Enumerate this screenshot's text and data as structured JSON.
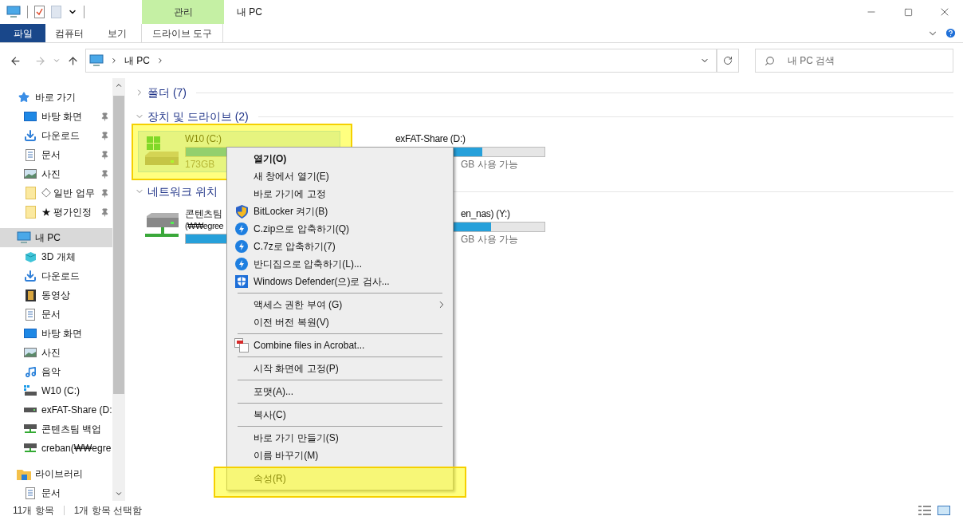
{
  "window": {
    "title": "내 PC",
    "context_tab_group": "관리"
  },
  "ribbon_tabs": [
    {
      "label": "파일",
      "kind": "file"
    },
    {
      "label": "컴퓨터",
      "kind": "tab"
    },
    {
      "label": "보기",
      "kind": "tab"
    },
    {
      "label": "드라이브 도구",
      "kind": "context"
    }
  ],
  "address_bar": {
    "segments": [
      "내 PC"
    ]
  },
  "search": {
    "placeholder": "내 PC 검색"
  },
  "nav": [
    {
      "label": "바로 가기",
      "kind": "star",
      "selected": false,
      "children": [
        {
          "label": "바탕 화면",
          "kind": "desktop",
          "pinned": true,
          "selected": false
        },
        {
          "label": "다운로드",
          "kind": "download",
          "pinned": true,
          "selected": false
        },
        {
          "label": "문서",
          "kind": "document",
          "pinned": true,
          "selected": false
        },
        {
          "label": "사진",
          "kind": "picture",
          "pinned": true,
          "selected": false
        },
        {
          "label": "◇ 일반 업무",
          "kind": "folder",
          "pinned": true,
          "selected": false
        },
        {
          "label": "★ 평가인정",
          "kind": "folder",
          "pinned": true,
          "selected": false
        }
      ]
    },
    {
      "label": "내 PC",
      "kind": "pc",
      "selected": true,
      "children": [
        {
          "label": "3D 개체",
          "kind": "cube",
          "pinned": false,
          "selected": false
        },
        {
          "label": "다운로드",
          "kind": "download",
          "pinned": false,
          "selected": false
        },
        {
          "label": "동영상",
          "kind": "video",
          "pinned": false,
          "selected": false
        },
        {
          "label": "문서",
          "kind": "document",
          "pinned": false,
          "selected": false
        },
        {
          "label": "바탕 화면",
          "kind": "desktop",
          "pinned": false,
          "selected": false
        },
        {
          "label": "사진",
          "kind": "picture",
          "pinned": false,
          "selected": false
        },
        {
          "label": "음악",
          "kind": "music",
          "pinned": false,
          "selected": false
        },
        {
          "label": "W10 (C:)",
          "kind": "windrive",
          "pinned": false,
          "selected": false
        },
        {
          "label": "exFAT-Share (D:",
          "kind": "drive",
          "pinned": false,
          "selected": false
        },
        {
          "label": "콘텐츠팀 백업",
          "kind": "netdrive",
          "pinned": false,
          "selected": false
        },
        {
          "label": "creban(₩₩egre",
          "kind": "netdrive",
          "pinned": false,
          "selected": false
        }
      ]
    },
    {
      "label": "라이브러리",
      "kind": "library",
      "selected": false,
      "children": [
        {
          "label": "문서",
          "kind": "document",
          "pinned": false,
          "selected": false
        }
      ]
    }
  ],
  "sections": [
    {
      "title": "폴더 (7)",
      "expanded": false
    },
    {
      "title": "장치 및 드라이브 (2)",
      "expanded": true,
      "items": [
        {
          "label_lines": [
            "W10 (C:)"
          ],
          "kind": "windrive",
          "level": 0.7,
          "info": "173GB",
          "selected": true
        },
        {
          "label_lines": [
            "exFAT-Share (D:)"
          ],
          "kind": "covered",
          "level": 0.58,
          "info": "GB 사용 가능",
          "selected": false
        }
      ]
    },
    {
      "title": "네트워크 위치",
      "expanded": true,
      "items": [
        {
          "label_lines": [
            "콘텐츠팀",
            "(₩₩egree"
          ],
          "kind": "netdrive",
          "level": 0.5,
          "selected": false
        },
        {
          "label_lines": [
            "en_nas) (Y:)"
          ],
          "kind": "covered",
          "level": 0.64,
          "info": "GB 사용 가능",
          "selected": false
        }
      ]
    }
  ],
  "context_menu": [
    {
      "kind": "plain",
      "label": "열기(O)",
      "default": true
    },
    {
      "kind": "plain",
      "label": "새 창에서 열기(E)",
      "default": false
    },
    {
      "kind": "plain",
      "label": "바로 가기에 고정",
      "default": false
    },
    {
      "kind": "shield",
      "label": "BitLocker 켜기(B)",
      "default": false
    },
    {
      "kind": "bandizip",
      "label": "C.zip으로 압축하기(Q)",
      "default": false
    },
    {
      "kind": "bandizip",
      "label": "C.7z로 압축하기(7)",
      "default": false
    },
    {
      "kind": "bandizip",
      "label": "반디집으로 압축하기(L)...",
      "default": false
    },
    {
      "kind": "defender",
      "label": "Windows Defender(으)로 검사...",
      "default": false
    },
    {
      "kind": "separator"
    },
    {
      "kind": "submenu",
      "label": "액세스 권한 부여 (G)",
      "default": false
    },
    {
      "kind": "plain",
      "label": "이전 버전 복원(V)",
      "default": false
    },
    {
      "kind": "separator"
    },
    {
      "kind": "acrobat",
      "label": "Combine files in Acrobat...",
      "default": false
    },
    {
      "kind": "separator"
    },
    {
      "kind": "plain",
      "label": "시작 화면에 고정(P)",
      "default": false
    },
    {
      "kind": "separator"
    },
    {
      "kind": "plain",
      "label": "포맷(A)...",
      "default": false
    },
    {
      "kind": "separator"
    },
    {
      "kind": "plain",
      "label": "복사(C)",
      "default": false
    },
    {
      "kind": "separator"
    },
    {
      "kind": "plain",
      "label": "바로 가기 만들기(S)",
      "default": false
    },
    {
      "kind": "plain",
      "label": "이름 바꾸기(M)",
      "default": false
    },
    {
      "kind": "separator"
    },
    {
      "kind": "plain",
      "label": "속성(R)",
      "default": false
    }
  ],
  "status_bar": {
    "count": "11개 항목",
    "selection": "1개 항목 선택함"
  }
}
